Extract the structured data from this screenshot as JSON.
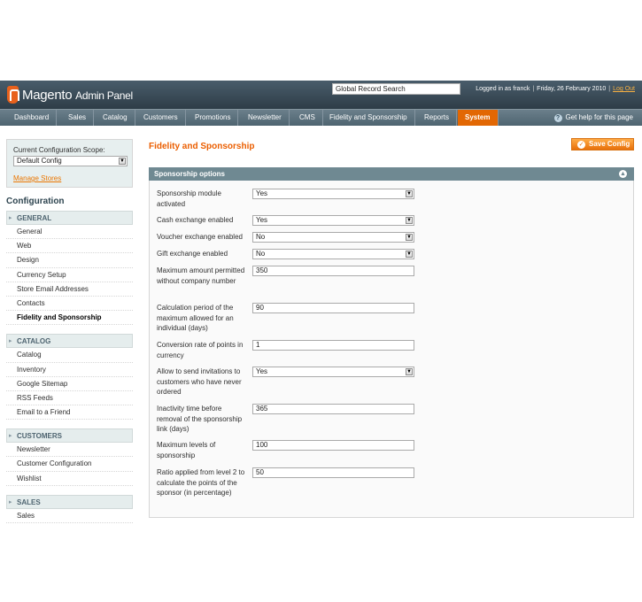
{
  "header": {
    "logo_brand": "Magento",
    "logo_sub": "Admin Panel",
    "search_value": "Global Record Search",
    "logged_in": "Logged in as franck",
    "date": "Friday, 26 February 2010",
    "logout": "Log Out"
  },
  "nav": {
    "items": [
      "Dashboard",
      "Sales",
      "Catalog",
      "Customers",
      "Promotions",
      "Newsletter",
      "CMS",
      "Fidelity and Sponsorship",
      "Reports",
      "System"
    ],
    "active": "System",
    "help": "Get help for this page"
  },
  "sidebar": {
    "scope_label": "Current Configuration Scope:",
    "scope_value": "Default Config",
    "manage_stores": "Manage Stores",
    "config_title": "Configuration",
    "groups": [
      {
        "title": "GENERAL",
        "items": [
          "General",
          "Web",
          "Design",
          "Currency Setup",
          "Store Email Addresses",
          "Contacts",
          "Fidelity and Sponsorship"
        ]
      },
      {
        "title": "CATALOG",
        "items": [
          "Catalog",
          "Inventory",
          "Google Sitemap",
          "RSS Feeds",
          "Email to a Friend"
        ]
      },
      {
        "title": "CUSTOMERS",
        "items": [
          "Newsletter",
          "Customer Configuration",
          "Wishlist"
        ]
      },
      {
        "title": "SALES",
        "items": [
          "Sales"
        ]
      }
    ],
    "active_item": "Fidelity and Sponsorship"
  },
  "main": {
    "title": "Fidelity and Sponsorship",
    "save_label": "Save Config",
    "section_title": "Sponsorship options",
    "fields": [
      {
        "label": "Sponsorship module activated",
        "value": "Yes",
        "type": "select"
      },
      {
        "label": "Cash exchange enabled",
        "value": "Yes",
        "type": "select"
      },
      {
        "label": "Voucher exchange enabled",
        "value": "No",
        "type": "select"
      },
      {
        "label": "Gift exchange enabled",
        "value": "No",
        "type": "select"
      },
      {
        "label": "Maximum amount permitted without company number",
        "value": "350",
        "type": "text"
      },
      {
        "label": "Calculation period of the maximum allowed for an individual (days)",
        "value": "90",
        "type": "text"
      },
      {
        "label": "Conversion rate of points in currency",
        "value": "1",
        "type": "text"
      },
      {
        "label": "Allow to send invitations to customers who have never ordered",
        "value": "Yes",
        "type": "select"
      },
      {
        "label": "Inactivity time before removal of the sponsorship link (days)",
        "value": "365",
        "type": "text"
      },
      {
        "label": "Maximum levels of sponsorship",
        "value": "100",
        "type": "text"
      },
      {
        "label": "Ratio applied from level 2 to calculate the points of the sponsor (in percentage)",
        "value": "50",
        "type": "text"
      }
    ]
  },
  "colors": {
    "header_bg": "#2e3d47",
    "nav_bg": "#4e6470",
    "accent_orange": "#eb5e00",
    "section_head": "#6f8992"
  }
}
